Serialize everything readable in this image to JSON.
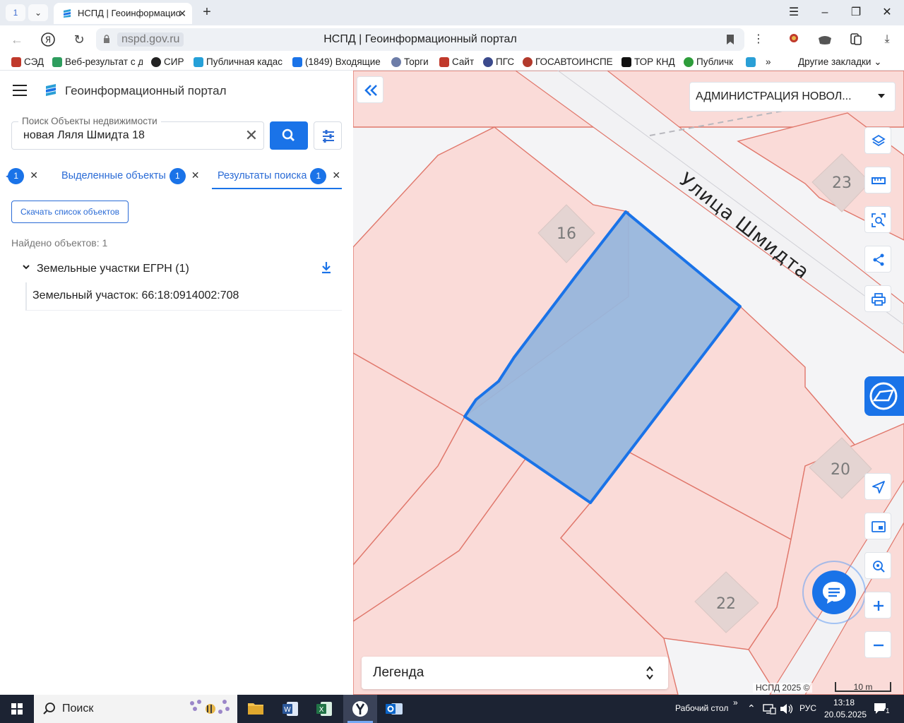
{
  "browser": {
    "tab_counter": "1",
    "tab_title": "НСПД | Геоинформацио",
    "url_domain": "nspd.gov.ru",
    "page_title": "НСПД | Геоинформационный портал"
  },
  "bookmarks": [
    {
      "label": "СЭД",
      "color": "#c0392b"
    },
    {
      "label": "Веб-результат с д",
      "color": "#2e9d5e"
    },
    {
      "label": "СИР",
      "color": "#222222"
    },
    {
      "label": "Публичная кадас",
      "color": "#25a0d8"
    },
    {
      "label": "(1849) Входящие",
      "color": "#1a73e8"
    },
    {
      "label": "Торги",
      "color": "#6d7da8"
    },
    {
      "label": "Сайт",
      "color": "#c0392b"
    },
    {
      "label": "ПГС",
      "color": "#3b4a8c"
    },
    {
      "label": "ГОСАВТОИНСПЕ",
      "color": "#b23a2c"
    },
    {
      "label": "ТОР КНД",
      "color": "#111111"
    },
    {
      "label": "Публичк",
      "color": "#2e9d3b"
    }
  ],
  "bookmarks_more": "»",
  "bookmarks_other": "Другие закладки",
  "panel": {
    "portal_title": "Геоинформационный портал",
    "search_label": "Поиск Объекты недвижимости",
    "search_value": "новая Ляля Шмидта 18",
    "tabs": [
      {
        "label": "",
        "count": "1"
      },
      {
        "label": "Выделенные объекты",
        "count": "1"
      },
      {
        "label": "Результаты поиска",
        "count": "1"
      }
    ],
    "download_list_label": "Скачать список объектов",
    "found_text": "Найдено объектов: 1",
    "group_label": "Земельные участки ЕГРН (1)",
    "item_label": "Земельный участок: 66:18:0914002:708"
  },
  "map": {
    "region_select": "АДМИНИСТРАЦИЯ НОВОЛ...",
    "street_label": "Улица Шмидта",
    "house_numbers": [
      "16",
      "23",
      "20",
      "22"
    ],
    "legend_label": "Легенда",
    "copyright": "НСПД 2025 ©",
    "scale_label": "10 m",
    "colors": {
      "parcel_fill": "#fadbd8",
      "parcel_stroke": "#e0776b",
      "selected_fill": "#98b6dc",
      "selected_stroke": "#1a73e8",
      "accent": "#1a73e8"
    }
  },
  "taskbar": {
    "search_label": "Поиск",
    "desktop_label": "Рабочий стол",
    "lang": "РУС",
    "time": "13:18",
    "date": "20.05.2025",
    "notifications": "1"
  }
}
